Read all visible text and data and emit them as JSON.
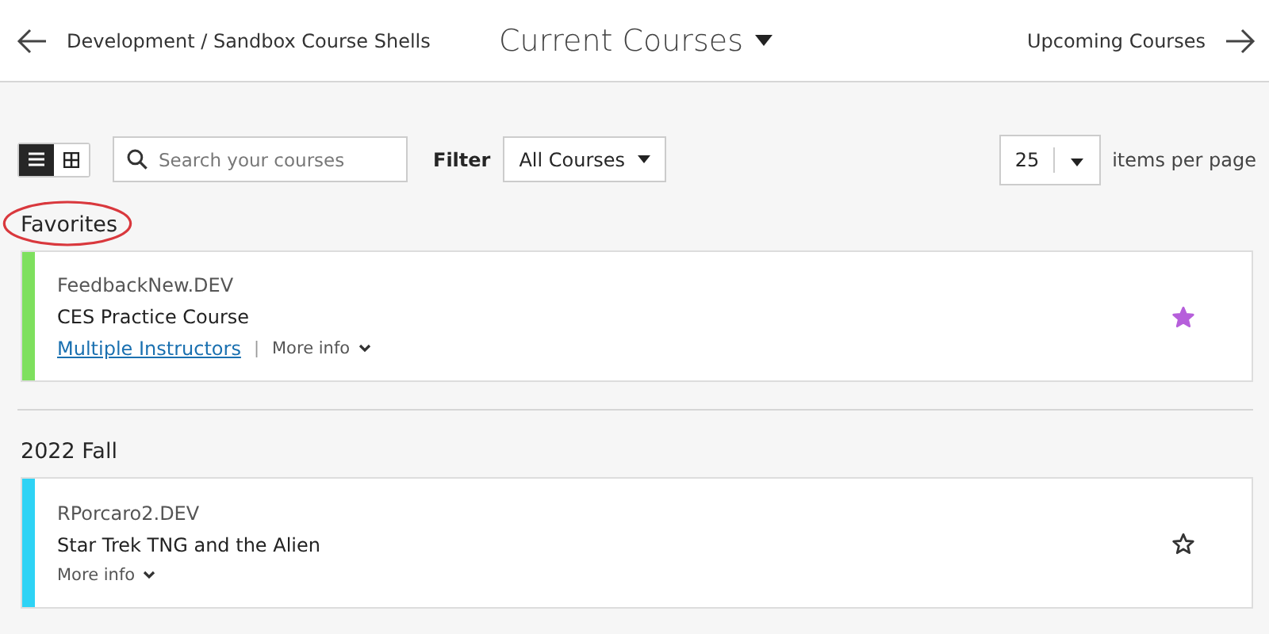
{
  "header": {
    "back_label": "Development / Sandbox Course Shells",
    "title": "Current Courses",
    "next_label": "Upcoming Courses"
  },
  "toolbar": {
    "views": [
      {
        "kind": "list",
        "selected": true
      },
      {
        "kind": "grid",
        "selected": false
      }
    ],
    "search": {
      "placeholder": "Search your courses"
    },
    "filter_label": "Filter",
    "filter_value": "All Courses",
    "page_size": "25",
    "page_size_label": "items per page"
  },
  "sections": [
    {
      "heading": "Favorites",
      "circled": true,
      "courses": [
        {
          "code": "FeedbackNew.DEV",
          "title": "CES Practice Course",
          "instructors": "Multiple Instructors",
          "separator": "|",
          "more_info": "More info",
          "favorite": true,
          "color": "#7ee05e"
        }
      ]
    },
    {
      "heading": "2022 Fall",
      "circled": false,
      "courses": [
        {
          "code": "RPorcaro2.DEV",
          "title": "Star Trek TNG and the Alien",
          "more_info": "More info",
          "favorite": false,
          "color": "#2ed3f5"
        }
      ]
    }
  ]
}
